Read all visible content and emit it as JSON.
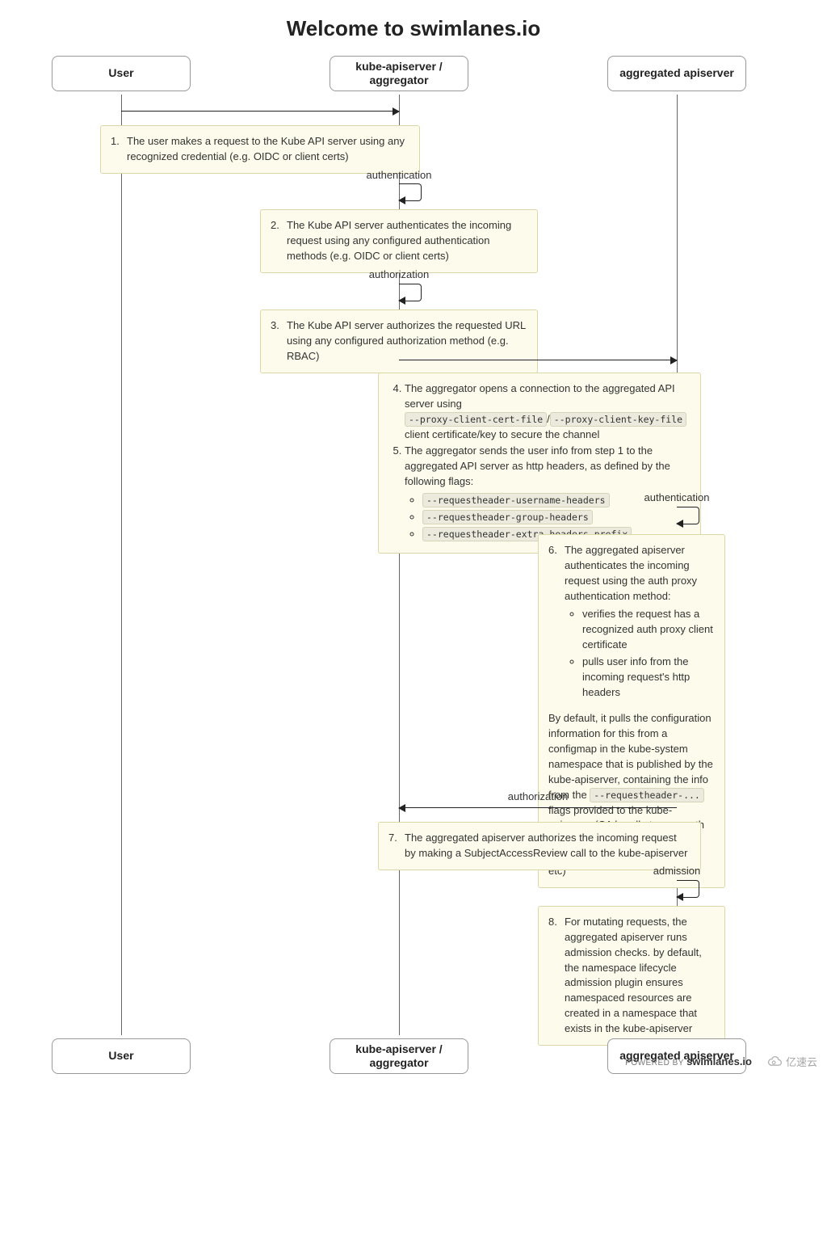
{
  "title": "Welcome to swimlanes.io",
  "lanes": {
    "user": "User",
    "kube": "kube-apiserver / aggregator",
    "agg": "aggregated apiserver"
  },
  "labels": {
    "authn1": "authentication",
    "authz1": "authorization",
    "authn2": "authentication",
    "authz2": "authorization",
    "admission": "admission"
  },
  "steps": {
    "s1_num": "1.",
    "s1": "The user makes a request to the Kube API server using any recognized credential (e.g. OIDC or client certs)",
    "s2_num": "2.",
    "s2": "The Kube API server authenticates the incoming request using any configured authentication methods (e.g. OIDC or client certs)",
    "s3_num": "3.",
    "s3": "The Kube API server authorizes the requested URL using any configured authorization method (e.g. RBAC)",
    "s4_num": "4.",
    "s4_a": "The aggregator opens a connection to the aggregated API server using ",
    "s4_code1": "--proxy-client-cert-file",
    "s4_sep": "/",
    "s4_code2": "--proxy-client-key-file",
    "s4_b": " client certificate/key to secure the channel",
    "s5_num": "5.",
    "s5": "The aggregator sends the user info from step 1 to the aggregated API server as http headers, as defined by the following flags:",
    "s5_f1": "--requestheader-username-headers",
    "s5_f2": "--requestheader-group-headers",
    "s5_f3": "--requestheader-extra-headers-prefix",
    "s6_num": "6.",
    "s6_a": "The aggregated apiserver authenticates the incoming request using the auth proxy authentication method:",
    "s6_b1": "verifies the request has a recognized auth proxy client certificate",
    "s6_b2": "pulls user info from the incoming request's http headers",
    "s6_c_a": "By default, it pulls the configuration information for this from a configmap in the kube-system namespace that is published by the kube-apiserver, containing the info from the ",
    "s6_code": "--requestheader-...",
    "s6_c_b": " flags provided to the kube-apiserver (CA bundle to use, auth proxy client certificate names to allow, http header names to use, etc)",
    "s7_num": "7.",
    "s7": "The aggregated apiserver authorizes the incoming request by making a SubjectAccessReview call to the kube-apiserver",
    "s8_num": "8.",
    "s8": "For mutating requests, the aggregated apiserver runs admission checks. by default, the namespace lifecycle admission plugin ensures namespaced resources are created in a namespace that exists in the kube-apiserver"
  },
  "footer": {
    "powered": "POWERED BY",
    "brand": "swimlanes.io",
    "watermark": "亿速云"
  }
}
